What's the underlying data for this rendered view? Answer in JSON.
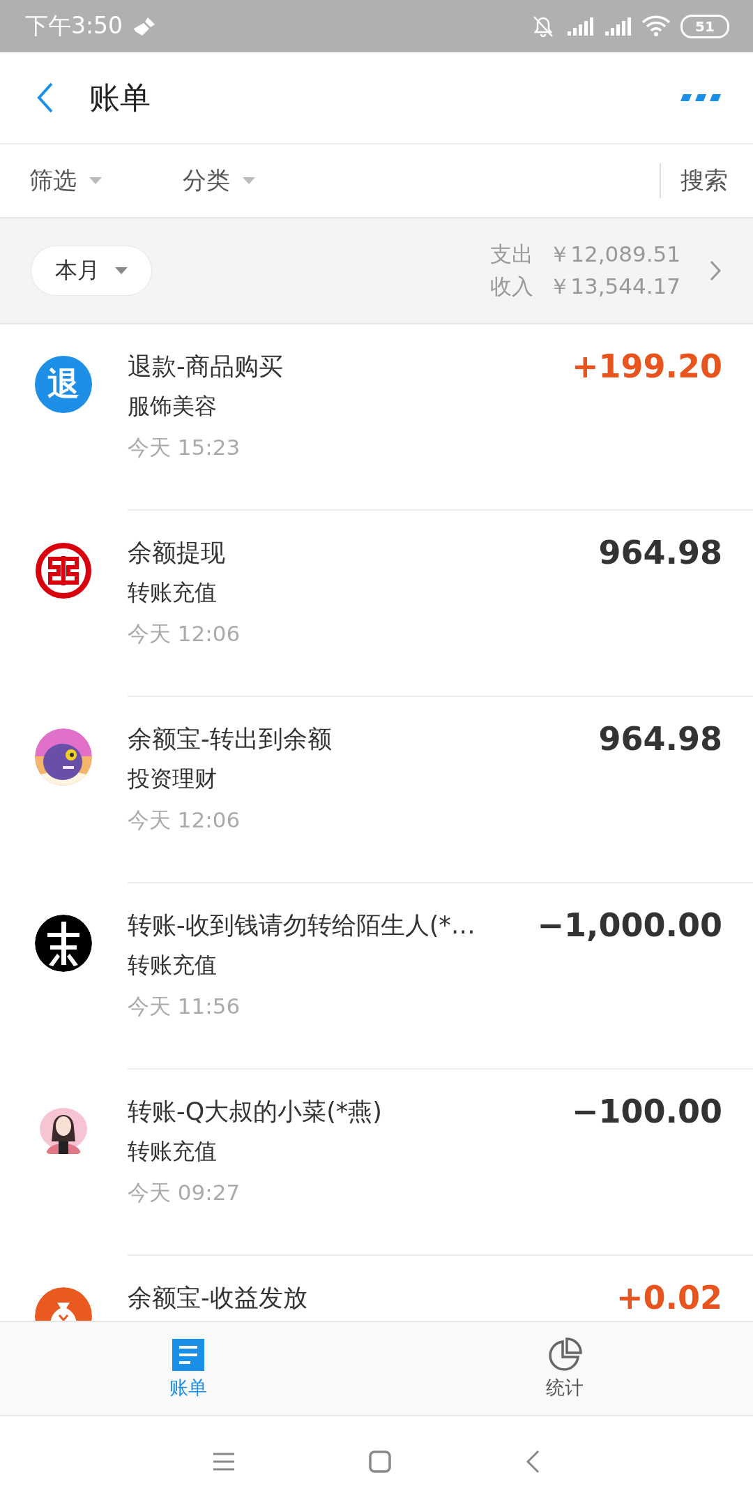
{
  "status_bar": {
    "time": "下午3:50",
    "battery": "51"
  },
  "header": {
    "title": "账单"
  },
  "filters": [
    {
      "label": "筛选",
      "kind": "dropdown"
    },
    {
      "label": "分类",
      "kind": "dropdown"
    },
    {
      "label": "搜索",
      "kind": "search"
    }
  ],
  "summary": {
    "period": "本月",
    "expense_label": "支出",
    "expense": "￥12,089.51",
    "income_label": "收入",
    "income": "￥13,544.17"
  },
  "transactions": [
    {
      "avatar": {
        "kind": "text",
        "label": "退",
        "color": "#1e8fe6"
      },
      "title": "退款-商品购买",
      "category": "服饰美容",
      "time": "今天 15:23",
      "amount": "+199.20",
      "income": true
    },
    {
      "avatar": {
        "kind": "bank"
      },
      "title": "余额提现",
      "category": "转账充值",
      "time": "今天 12:06",
      "amount": "964.98",
      "income": false
    },
    {
      "title": "余额宝-转出到余额",
      "category": "投资理财",
      "time": "今天 12:06",
      "amount": "964.98",
      "income": false
    },
    {
      "title": "转账-收到钱请勿转给陌生人(*…",
      "category": "转账充值",
      "time": "今天 11:56",
      "amount": "−1,000.00",
      "income": false
    },
    {
      "title": "转账-Q大叔的小菜(*燕)",
      "category": "转账充值",
      "time": "今天 09:27",
      "amount": "−100.00",
      "income": false
    },
    {
      "avatar": {
        "kind": "bag"
      },
      "title": "余额宝-收益发放",
      "amount": "+0.02",
      "income": true
    }
  ],
  "tabs": [
    {
      "label": "账单",
      "kind": "bill",
      "selected": true
    },
    {
      "label": "统计",
      "kind": "stats",
      "selected": false
    }
  ]
}
